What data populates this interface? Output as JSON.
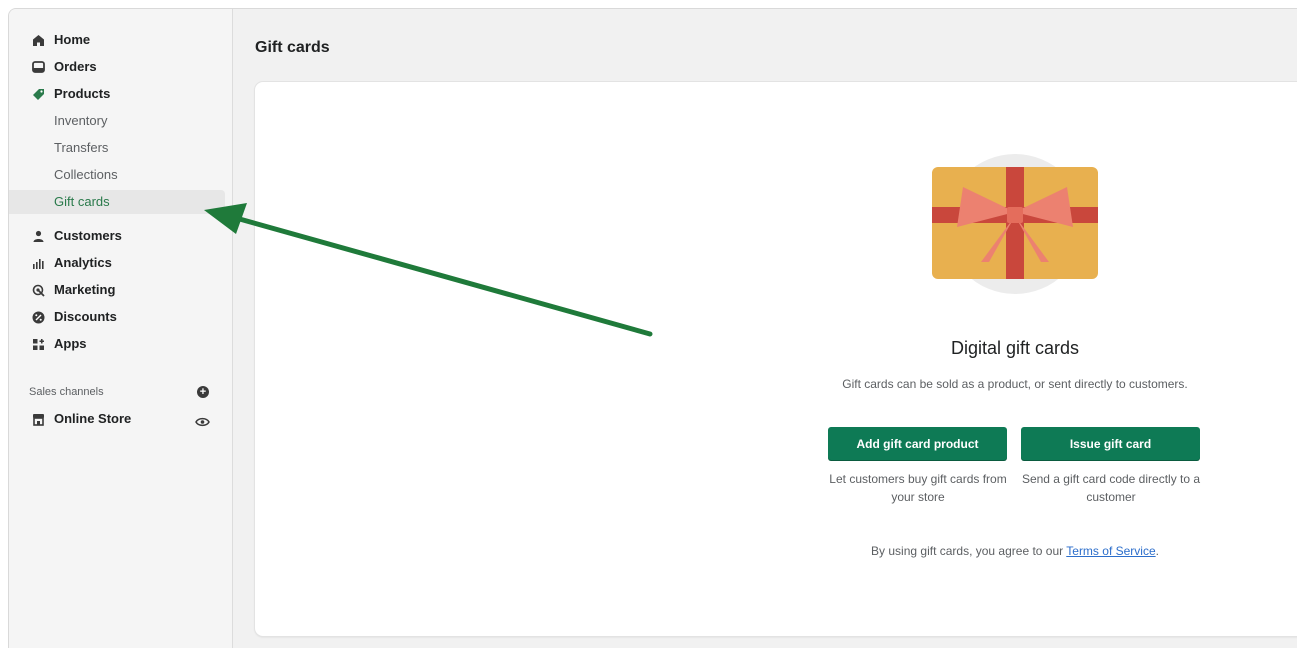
{
  "nav": {
    "items": [
      {
        "label": "Home",
        "icon": "home-icon"
      },
      {
        "label": "Orders",
        "icon": "orders-icon"
      },
      {
        "label": "Products",
        "icon": "products-tag-icon"
      },
      {
        "label": "Inventory"
      },
      {
        "label": "Transfers"
      },
      {
        "label": "Collections"
      },
      {
        "label": "Gift cards"
      },
      {
        "label": "Customers",
        "icon": "customers-icon"
      },
      {
        "label": "Analytics",
        "icon": "analytics-icon"
      },
      {
        "label": "Marketing",
        "icon": "marketing-icon"
      },
      {
        "label": "Discounts",
        "icon": "discounts-icon"
      },
      {
        "label": "Apps",
        "icon": "apps-icon"
      }
    ],
    "sales_channels_label": "Sales channels",
    "online_store_label": "Online Store"
  },
  "page": {
    "title": "Gift cards"
  },
  "empty_state": {
    "title": "Digital gift cards",
    "description": "Gift cards can be sold as a product, or sent directly to customers.",
    "primary_button": "Add gift card product",
    "primary_caption": "Let customers buy gift cards from your store",
    "secondary_button": "Issue gift card",
    "secondary_caption": "Send a gift card code directly to a customer",
    "tos_prefix": "By using gift cards, you agree to our",
    "tos_link": "Terms of Service",
    "tos_suffix": "."
  },
  "colors": {
    "accent": "#0e7a55",
    "annotation_arrow": "#1f7a3a",
    "link": "#2c6ecb"
  }
}
